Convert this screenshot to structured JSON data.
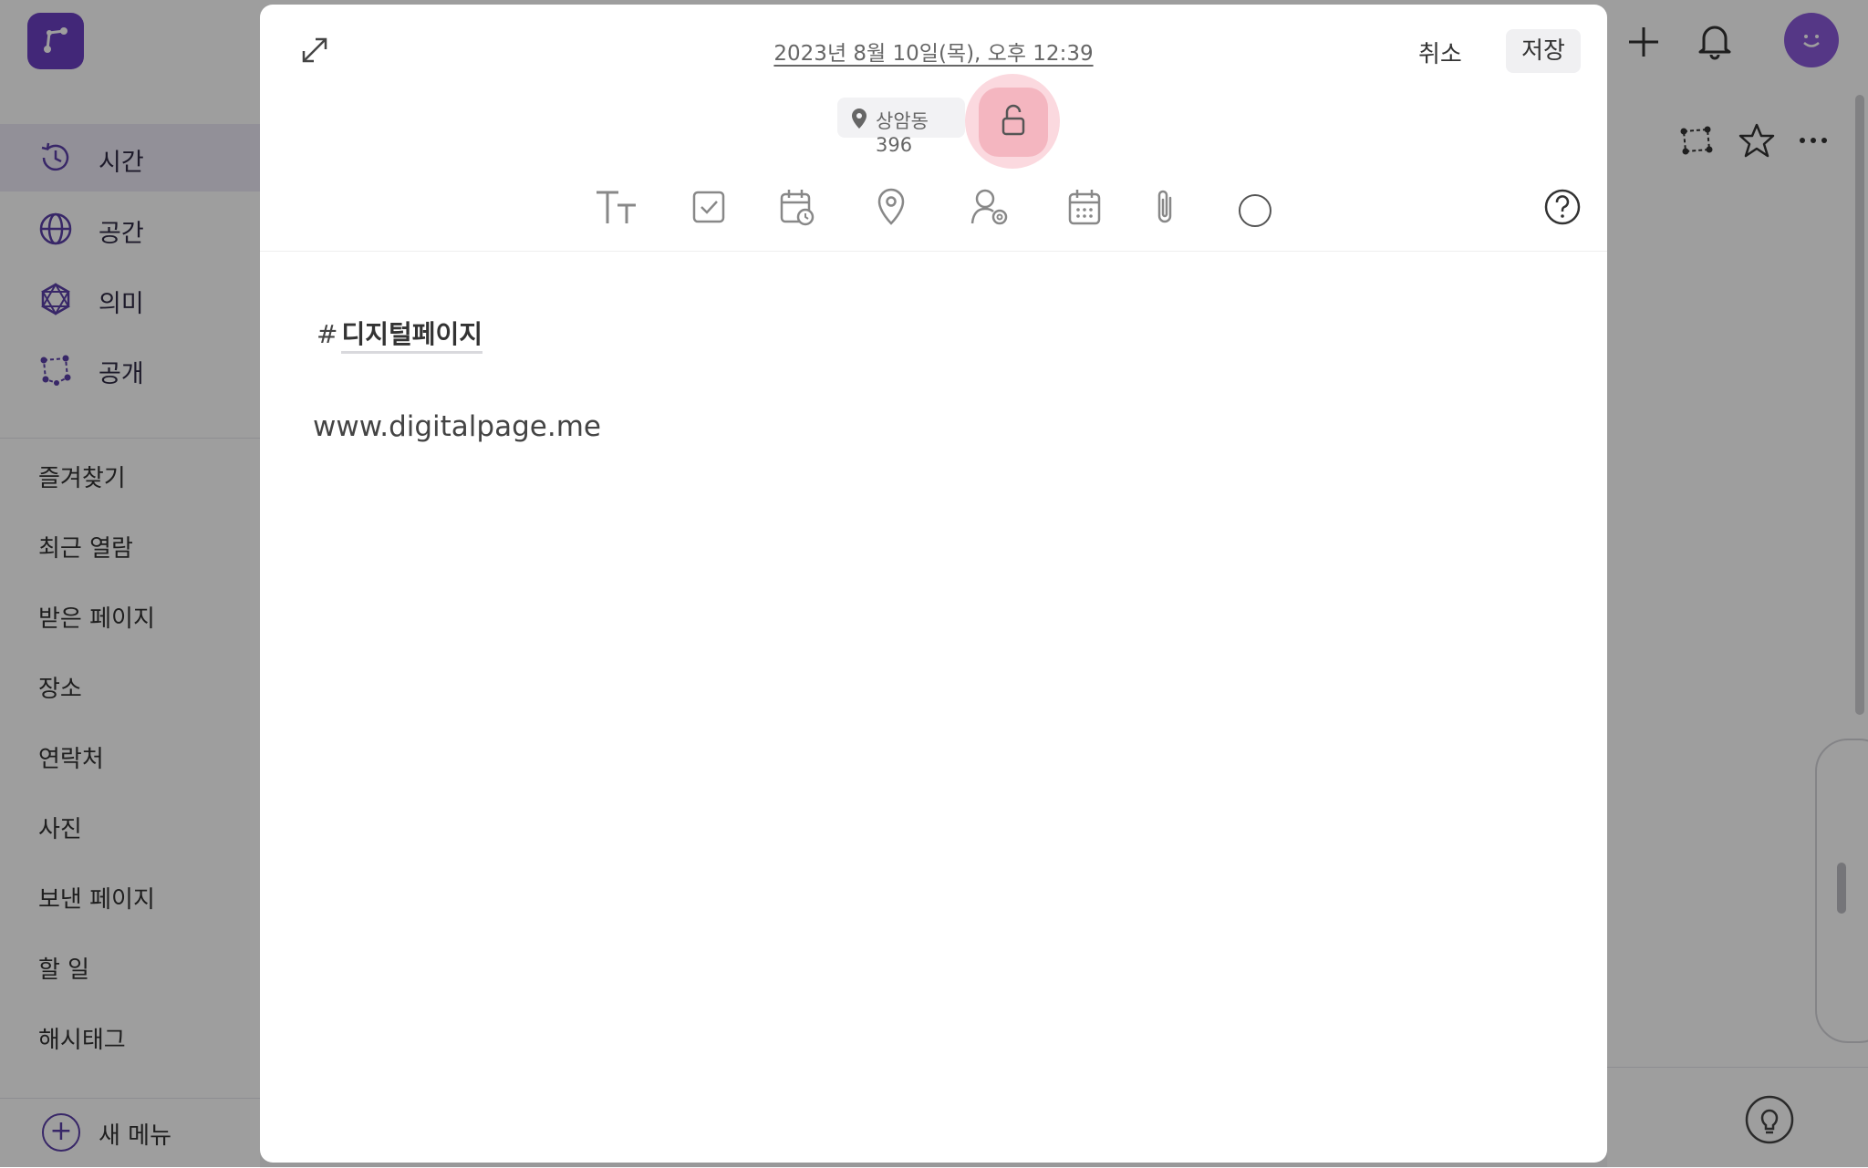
{
  "sidebar": {
    "nav": [
      {
        "label": "시간",
        "icon": "clock-history-icon"
      },
      {
        "label": "공간",
        "icon": "globe-icon"
      },
      {
        "label": "의미",
        "icon": "network-icon"
      },
      {
        "label": "공개",
        "icon": "share-network-icon"
      }
    ],
    "menu": [
      "즐겨찾기",
      "최근 열람",
      "받은 페이지",
      "장소",
      "연락처",
      "사진",
      "보낸 페이지",
      "할 일",
      "해시태그"
    ],
    "new_menu": "새 메뉴",
    "plus_glyph": "+"
  },
  "modal": {
    "datetime": "2023년 8월 10일(목), 오후 12:39",
    "cancel": "취소",
    "save": "저장",
    "location": "상암동 396",
    "hash_symbol": "#",
    "hashtag": "디지털페이지",
    "body_text": "www.digitalpage.me"
  },
  "colors": {
    "brand": "#6b3fc2",
    "lock_button": "#f4b6c0",
    "lock_halo": "#fbd9df"
  }
}
